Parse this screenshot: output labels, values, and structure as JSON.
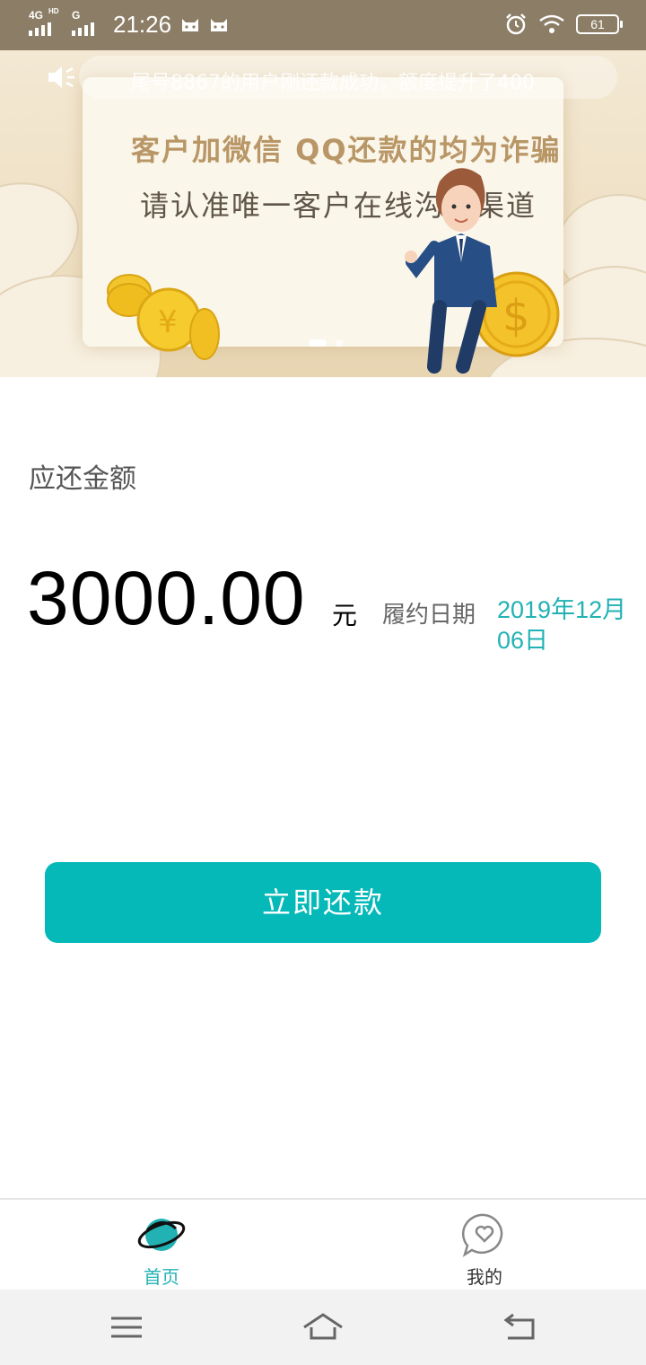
{
  "status_bar": {
    "network_label": "4G",
    "network_sub": "HD",
    "network_label_2": "G",
    "time": "21:26",
    "battery": "61"
  },
  "banner": {
    "notice": "尾号8867的用户刚还款成功，额度提升了400",
    "line1": "客户加微信 QQ还款的均为诈骗",
    "line2": "请认准唯一客户在线沟通渠道"
  },
  "main": {
    "amount_label": "应还金额",
    "amount": "3000.00",
    "unit": "元",
    "due_label": "履约日期",
    "due_date": "2019年12月06日"
  },
  "repay_button": {
    "label": "立即还款"
  },
  "tabs": [
    {
      "label": "首页",
      "icon": "planet-icon",
      "active": true
    },
    {
      "label": "我的",
      "icon": "heart-chat-icon",
      "active": false
    }
  ],
  "nav": {
    "icons": [
      "menu-icon",
      "home-icon",
      "back-icon"
    ]
  },
  "colors": {
    "accent": "#05b9b9",
    "status_bar": "#8c7e66",
    "date_text": "#22b2b4"
  }
}
